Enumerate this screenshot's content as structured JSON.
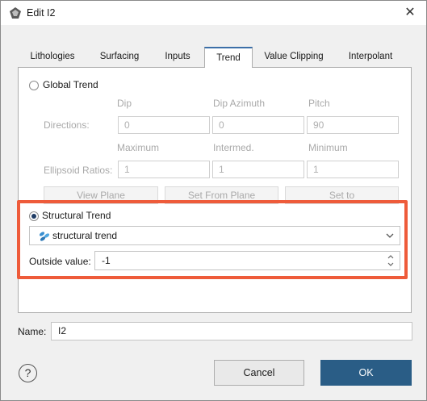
{
  "window": {
    "title": "Edit I2",
    "close_glyph": "✕"
  },
  "tabs": [
    {
      "label": "Lithologies"
    },
    {
      "label": "Surfacing"
    },
    {
      "label": "Inputs"
    },
    {
      "label": "Trend",
      "active": true
    },
    {
      "label": "Value Clipping"
    },
    {
      "label": "Interpolant"
    }
  ],
  "global_trend": {
    "radio_label": "Global Trend",
    "selected": false,
    "col_headers": {
      "a": "Dip",
      "b": "Dip Azimuth",
      "c": "Pitch"
    },
    "directions_label": "Directions:",
    "directions": {
      "dip": "0",
      "dip_azimuth": "0",
      "pitch": "90"
    },
    "col_headers2": {
      "a": "Maximum",
      "b": "Intermed.",
      "c": "Minimum"
    },
    "ellipsoid_label": "Ellipsoid Ratios:",
    "ellipsoid": {
      "maximum": "1",
      "intermed": "1",
      "minimum": "1"
    },
    "buttons": {
      "view_plane": "View Plane",
      "set_from_plane": "Set From Plane",
      "set_to": "Set to"
    }
  },
  "structural_trend": {
    "radio_label": "Structural Trend",
    "selected": true,
    "combo_value": "structural trend",
    "combo_icon": "structural-trend-icon",
    "outside_value_label": "Outside value:",
    "outside_value": "-1"
  },
  "name": {
    "label": "Name:",
    "value": "I2"
  },
  "footer": {
    "help_glyph": "?",
    "cancel_label": "Cancel",
    "ok_label": "OK"
  },
  "colors": {
    "highlight": "#ee5b3a",
    "ok_button": "#2a5d86",
    "active_tab": "#3c6fa8"
  }
}
